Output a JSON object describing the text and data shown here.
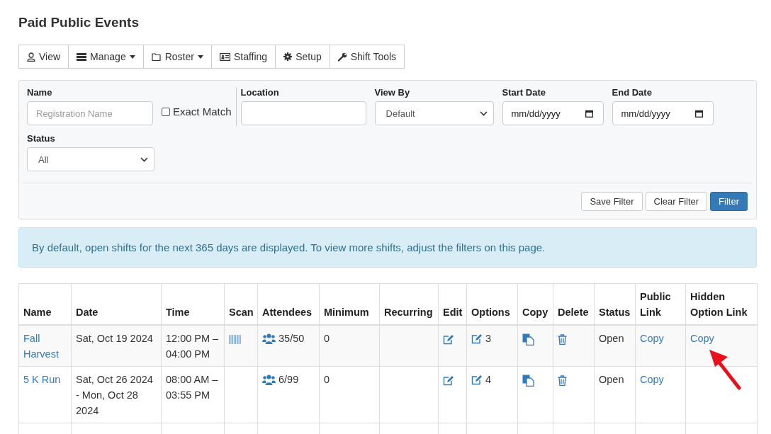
{
  "page": {
    "title": "Paid Public Events"
  },
  "toolbar": [
    {
      "label": "View",
      "dropdown": false
    },
    {
      "label": "Manage",
      "dropdown": true
    },
    {
      "label": "Roster",
      "dropdown": true
    },
    {
      "label": "Staffing",
      "dropdown": false
    },
    {
      "label": "Setup",
      "dropdown": false
    },
    {
      "label": "Shift Tools",
      "dropdown": false
    }
  ],
  "filters": {
    "name": {
      "label": "Name",
      "placeholder": "Registration Name"
    },
    "exact_match": {
      "label": "Exact Match",
      "checked": false
    },
    "location": {
      "label": "Location"
    },
    "view_by": {
      "label": "View By",
      "value": "Default"
    },
    "start_date": {
      "label": "Start Date",
      "value": "mm/dd/yyyy"
    },
    "end_date": {
      "label": "End Date",
      "value": "mm/dd/yyyy"
    },
    "status": {
      "label": "Status",
      "value": "All"
    },
    "buttons": [
      {
        "label": "Save Filter",
        "primary": false
      },
      {
        "label": "Clear Filter",
        "primary": false
      },
      {
        "label": "Filter",
        "primary": true
      }
    ]
  },
  "notice": "By default, open shifts for the next 365 days are displayed. To view more shifts, adjust the filters on this page.",
  "table": {
    "columns": [
      "Name",
      "Date",
      "Time",
      "Scan",
      "Attendees",
      "Minimum",
      "Recurring",
      "Edit",
      "Options",
      "Copy",
      "Delete",
      "Status",
      "Public Link",
      "Hidden Option Link"
    ],
    "rows": [
      {
        "name": "Fall Harvest",
        "date": "Sat, Oct 19 2024",
        "time": "12:00 PM – 04:00 PM",
        "scan": true,
        "attendees": "35/50",
        "minimum": "0",
        "options": "3",
        "status": "Open",
        "public_link": "Copy",
        "hidden_link": "Copy"
      },
      {
        "name": "5 K Run",
        "date": "Sat, Oct 26 2024 - Mon, Oct 28 2024",
        "time": "08:00 AM – 03:55 PM",
        "scan": false,
        "attendees": "6/99",
        "minimum": "0",
        "options": "4",
        "status": "Open",
        "public_link": "Copy"
      }
    ]
  }
}
